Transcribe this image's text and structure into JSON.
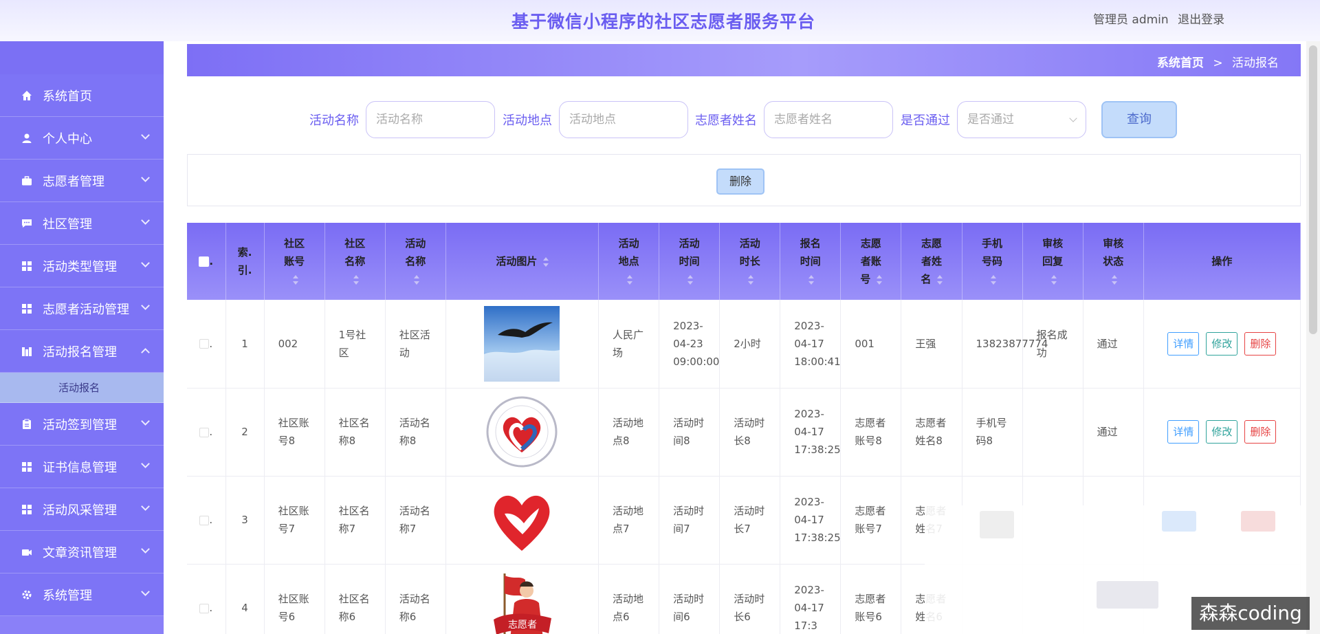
{
  "header": {
    "title": "基于微信小程序的社区志愿者服务平台",
    "user_label": "管理员 admin",
    "logout": "退出登录"
  },
  "sidebar": {
    "items": [
      {
        "label": "系统首页",
        "icon": "home-icon",
        "has_arrow": false
      },
      {
        "label": "个人中心",
        "icon": "user-icon",
        "has_arrow": true
      },
      {
        "label": "志愿者管理",
        "icon": "briefcase-icon",
        "has_arrow": true
      },
      {
        "label": "社区管理",
        "icon": "chat-icon",
        "has_arrow": true
      },
      {
        "label": "活动类型管理",
        "icon": "grid-icon",
        "has_arrow": true
      },
      {
        "label": "志愿者活动管理",
        "icon": "grid-icon",
        "has_arrow": true
      },
      {
        "label": "活动报名管理",
        "icon": "chart-icon",
        "has_arrow": true,
        "expanded": true
      },
      {
        "label": "活动签到管理",
        "icon": "clipboard-icon",
        "has_arrow": true
      },
      {
        "label": "证书信息管理",
        "icon": "grid-icon",
        "has_arrow": true
      },
      {
        "label": "活动风采管理",
        "icon": "grid-icon",
        "has_arrow": true
      },
      {
        "label": "文章资讯管理",
        "icon": "video-icon",
        "has_arrow": true
      },
      {
        "label": "系统管理",
        "icon": "gear-icon",
        "has_arrow": true
      }
    ],
    "sub_item": "活动报名"
  },
  "breadcrumb": {
    "home": "系统首页",
    "sep": ">",
    "current": "活动报名"
  },
  "search": {
    "name_label": "活动名称",
    "name_placeholder": "活动名称",
    "place_label": "活动地点",
    "place_placeholder": "活动地点",
    "volunteer_label": "志愿者姓名",
    "volunteer_placeholder": "志愿者姓名",
    "pass_label": "是否通过",
    "pass_placeholder": "是否通过",
    "query_button": "查询"
  },
  "actions": {
    "delete_button": "删除"
  },
  "table": {
    "columns": [
      "索引",
      "社区账号",
      "社区名称",
      "活动名称",
      "活动图片",
      "活动地点",
      "活动时间",
      "活动时长",
      "报名时间",
      "志愿者账号",
      "志愿者姓名",
      "手机号码",
      "审核回复",
      "审核状态",
      "操作"
    ],
    "rows": [
      {
        "index": "1",
        "community_account": "002",
        "community_name": "1号社区",
        "activity_name": "社区活动",
        "image": "eagle",
        "place": "人民广场",
        "time": "2023-04-23 09:00:00",
        "duration": "2小时",
        "signup_time": "2023-04-17 18:00:41",
        "volunteer_account": "001",
        "volunteer_name": "王强",
        "phone": "13823877774",
        "reply": "报名成功",
        "status": "通过"
      },
      {
        "index": "2",
        "community_account": "社区账号8",
        "community_name": "社区名称8",
        "activity_name": "活动名称8",
        "image": "china-heart-seal",
        "place": "活动地点8",
        "time": "活动时间8",
        "duration": "活动时长8",
        "signup_time": "2023-04-17 17:38:25",
        "volunteer_account": "志愿者账号8",
        "volunteer_name": "志愿者姓名8",
        "phone": "手机号码8",
        "reply": "",
        "status": "通过"
      },
      {
        "index": "3",
        "community_account": "社区账号7",
        "community_name": "社区名称7",
        "activity_name": "活动名称7",
        "image": "heart-hand",
        "place": "活动地点7",
        "time": "活动时间7",
        "duration": "活动时长7",
        "signup_time": "2023-04-17 17:38:25",
        "volunteer_account": "志愿者账号7",
        "volunteer_name": "志愿者姓名7",
        "phone": "",
        "reply": "",
        "status": ""
      },
      {
        "index": "4",
        "community_account": "社区账号6",
        "community_name": "社区名称6",
        "activity_name": "活动名称6",
        "image": "volunteer-girl",
        "place": "活动地点6",
        "time": "活动时间6",
        "duration": "活动时长6",
        "signup_time": "2023-04-17 17:3",
        "volunteer_account": "志愿者账号6",
        "volunteer_name": "志愿者姓名6",
        "phone": "",
        "reply": "",
        "status": ""
      }
    ],
    "op_detail": "详情",
    "op_edit": "修改",
    "op_delete": "删除"
  },
  "watermark": "森森coding"
}
